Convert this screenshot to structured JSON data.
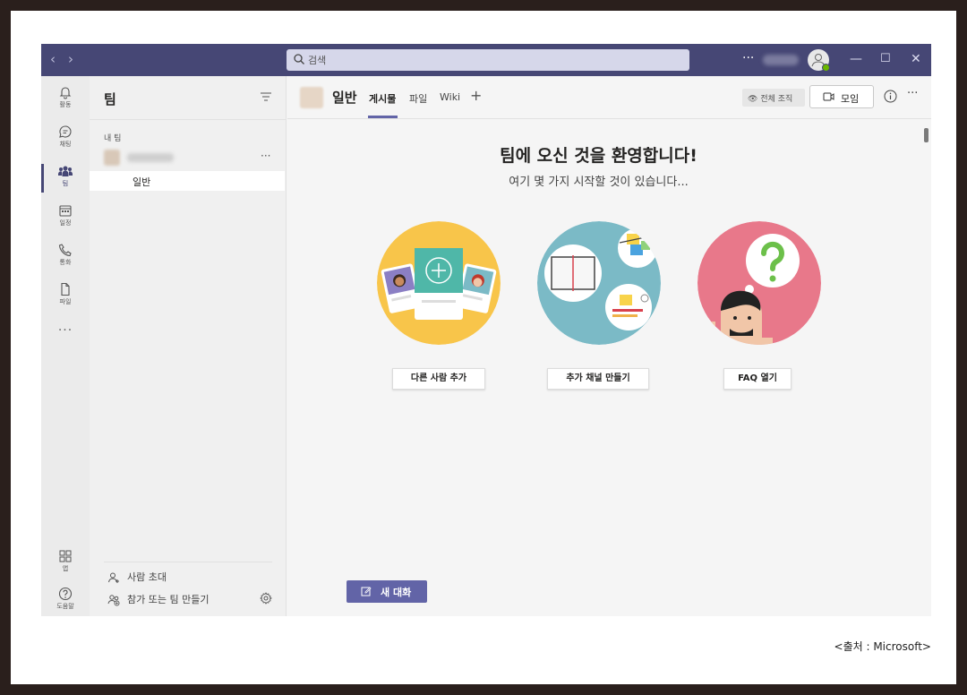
{
  "window": {
    "search_placeholder": "검색",
    "more_label": "···"
  },
  "rail": {
    "items": [
      {
        "label": "활동",
        "icon": "bell-icon"
      },
      {
        "label": "채팅",
        "icon": "chat-icon"
      },
      {
        "label": "팀",
        "icon": "teams-icon"
      },
      {
        "label": "일정",
        "icon": "calendar-icon"
      },
      {
        "label": "통화",
        "icon": "phone-icon"
      },
      {
        "label": "파일",
        "icon": "file-icon"
      }
    ],
    "more": "···",
    "apps_label": "앱",
    "help_label": "도움말"
  },
  "panel": {
    "title": "팀",
    "section_label": "내 팀",
    "team_more": "···",
    "channel_name": "일반",
    "invite_label": "사람 초대",
    "join_create_label": "참가 또는 팀 만들기"
  },
  "main": {
    "channel_title": "일반",
    "tabs": [
      {
        "label": "게시물",
        "active": true
      },
      {
        "label": "파일",
        "active": false
      },
      {
        "label": "Wiki",
        "active": false
      }
    ],
    "org_badge": "전체 조직",
    "meet_label": "모임",
    "welcome_title": "팀에 오신 것을 환영합니다!",
    "welcome_subtitle": "여기 몇 가지 시작할 것이 있습니다...",
    "actions": [
      {
        "label": "다른 사람 추가"
      },
      {
        "label": "추가 채널 만들기"
      },
      {
        "label": "FAQ 열기"
      }
    ],
    "new_conversation_label": "새 대화"
  },
  "caption": "<출처 : Microsoft>",
  "colors": {
    "titlebar": "#464775",
    "accent": "#6264a7",
    "illus_yellow": "#f8c54a",
    "illus_teal": "#7bbac6",
    "illus_pink": "#e8788a"
  }
}
